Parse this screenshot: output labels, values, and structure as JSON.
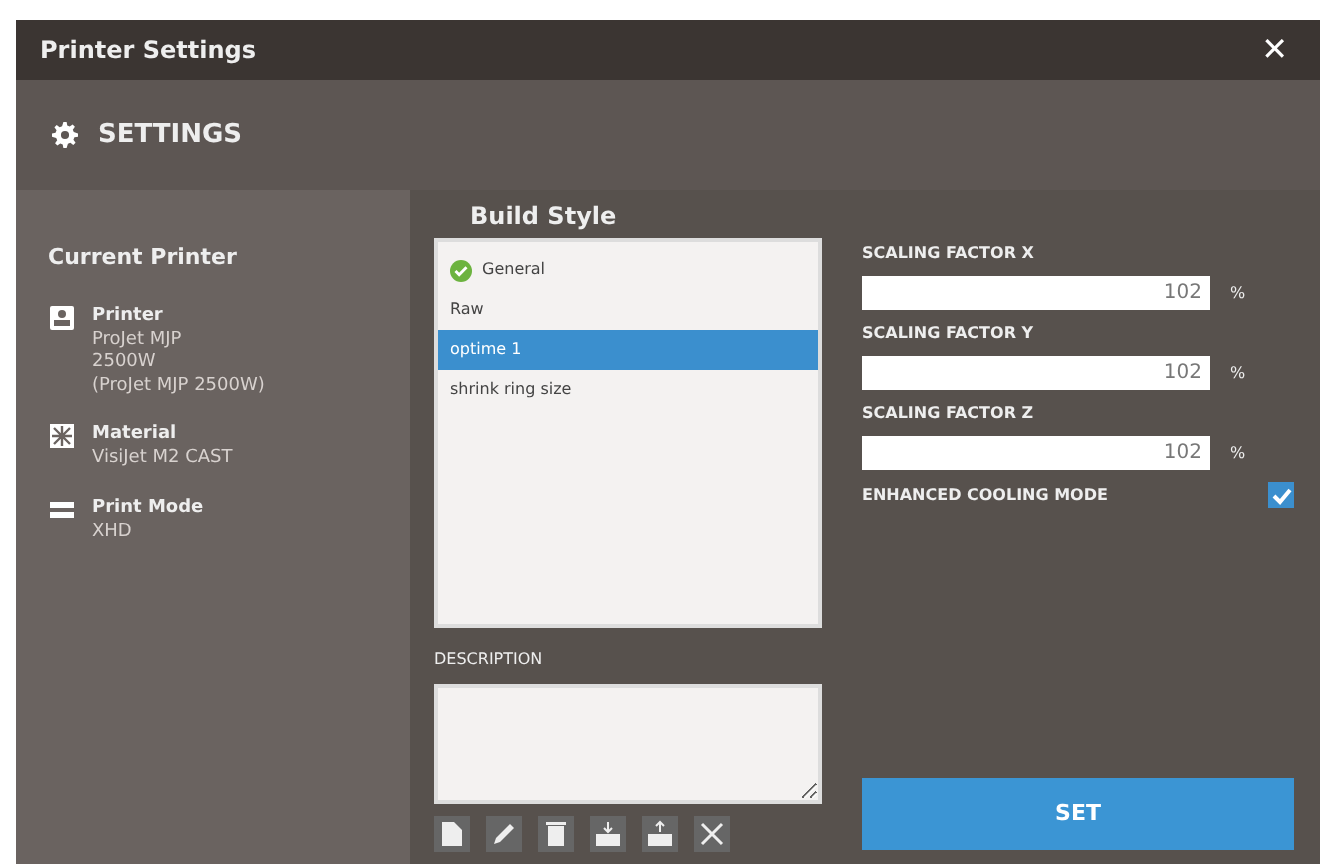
{
  "window": {
    "title": "Printer Settings",
    "close": "✕"
  },
  "header": {
    "title": "SETTINGS"
  },
  "current_printer": {
    "title": "Current Printer",
    "items": [
      {
        "kind": "printer",
        "label": "Printer",
        "lines": [
          "ProJet MJP",
          "2500W",
          "(ProJet MJP 2500W)"
        ]
      },
      {
        "kind": "material",
        "label": "Material",
        "lines": [
          "VisiJet M2 CAST"
        ]
      },
      {
        "kind": "mode",
        "label": "Print Mode",
        "lines": [
          "XHD"
        ]
      }
    ]
  },
  "build_style": {
    "title": "Build Style",
    "items": [
      {
        "label": "General",
        "default": true,
        "selected": false
      },
      {
        "label": "Raw",
        "default": false,
        "selected": false
      },
      {
        "label": "optime 1",
        "default": false,
        "selected": true
      },
      {
        "label": "shrink ring size",
        "default": false,
        "selected": false
      }
    ]
  },
  "description": {
    "label": "DESCRIPTION"
  },
  "scaling": [
    {
      "label": "SCALING FACTOR X",
      "value": "102",
      "unit": "%"
    },
    {
      "label": "SCALING FACTOR Y",
      "value": "102",
      "unit": "%"
    },
    {
      "label": "SCALING FACTOR Z",
      "value": "102",
      "unit": "%"
    }
  ],
  "enhanced_cooling": {
    "label": "ENHANCED COOLING MODE",
    "checked": true
  },
  "buttons": [
    "SET"
  ]
}
